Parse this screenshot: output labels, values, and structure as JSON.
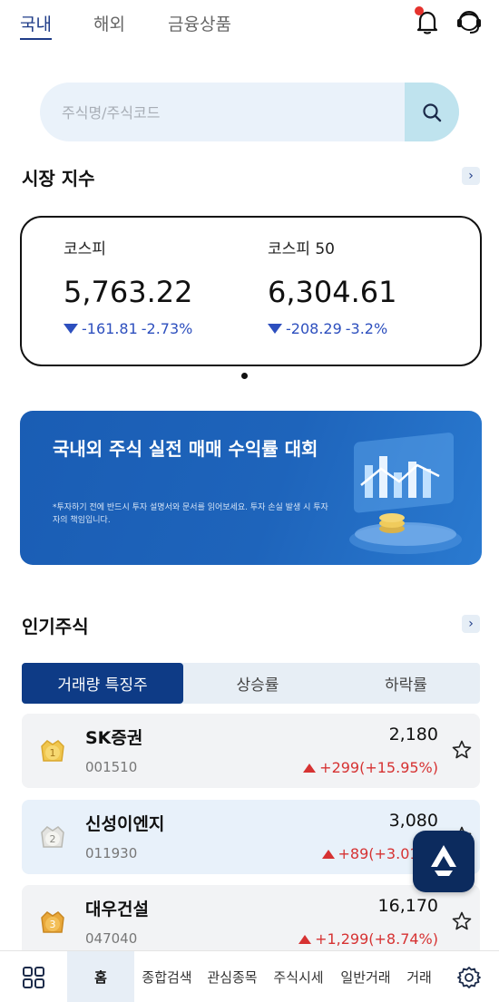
{
  "top_tabs": [
    {
      "label": "국내",
      "active": true
    },
    {
      "label": "해외",
      "active": false
    },
    {
      "label": "금융상품",
      "active": false
    }
  ],
  "search": {
    "placeholder": "주식명/주식코드"
  },
  "market_index": {
    "title": "시장 지수",
    "items": [
      {
        "name": "코스피",
        "value": "5,763.22",
        "change": "-161.81",
        "rate": "-2.73%"
      },
      {
        "name": "코스피 50",
        "value": "6,304.61",
        "change": "-208.29",
        "rate": "-3.2%"
      }
    ]
  },
  "banner": {
    "title": "국내외 주식 실전 매매 수익률 대회",
    "note": "*투자하기 전에 반드시 투자 설명서와 문서를 읽어보세요. 투자 손실 발생 시 투자자의 책임입니다."
  },
  "popular": {
    "title": "인기주식",
    "tabs": [
      {
        "label": "거래량 특징주",
        "active": true
      },
      {
        "label": "상승률",
        "active": false
      },
      {
        "label": "하락률",
        "active": false
      }
    ],
    "stocks": [
      {
        "rank": "1",
        "name": "SK증권",
        "code": "001510",
        "price": "2,180",
        "change": "+299(+15.95%)"
      },
      {
        "rank": "2",
        "name": "신성이엔지",
        "code": "011930",
        "price": "3,080",
        "change": "+89(+3.01%)"
      },
      {
        "rank": "3",
        "name": "대우건설",
        "code": "047040",
        "price": "16,170",
        "change": "+1,299(+8.74%)"
      }
    ]
  },
  "bottom_nav": [
    {
      "label": "홈",
      "active": true
    },
    {
      "label": "종합검색",
      "active": false
    },
    {
      "label": "관심종목",
      "active": false
    },
    {
      "label": "주식시세",
      "active": false
    },
    {
      "label": "일반거래",
      "active": false
    },
    {
      "label": "거래",
      "active": false
    }
  ],
  "colors": {
    "accent": "#0e3b86",
    "down": "#2d4fbe",
    "up": "#d63232",
    "alert": "#e5322d"
  }
}
